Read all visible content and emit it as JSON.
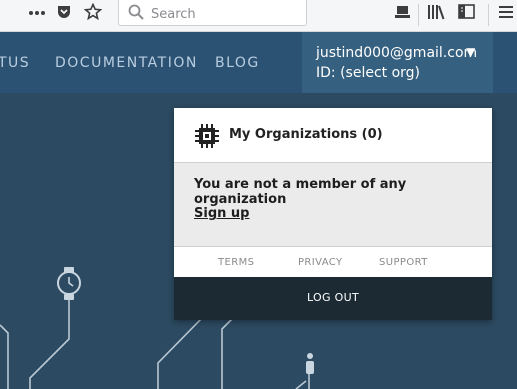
{
  "browser": {
    "search_placeholder": "Search",
    "icons": [
      "more-actions-icon",
      "pocket-icon",
      "bookmark-star-icon",
      "search-icon",
      "screenshot-icon",
      "library-icon",
      "sidebar-icon",
      "menu-icon"
    ]
  },
  "site_nav": {
    "links": [
      "TUS",
      "DOCUMENTATION",
      "BLOG"
    ]
  },
  "account": {
    "email": "justind000@gmail.com",
    "caret": "▼",
    "org": "ID: (select org)"
  },
  "dropdown": {
    "title": "My Organizations (0)",
    "message": "You are not a member of any organization",
    "signup": "Sign up",
    "footer_links": [
      "TERMS",
      "PRIVACY",
      "SUPPORT"
    ],
    "logout": "LOG OUT"
  }
}
